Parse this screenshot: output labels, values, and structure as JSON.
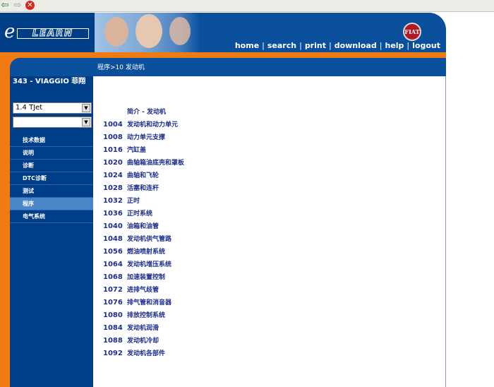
{
  "toolbar": {
    "back_icon": "arrow-left-icon",
    "forward_icon": "arrow-right-icon",
    "stop_icon": "stop-icon",
    "back_glyph": "⇦",
    "forward_glyph": "⇨",
    "stop_glyph": "✕"
  },
  "header": {
    "logo_e": "e",
    "logo_rest": "LEARN",
    "badge": "FIAT",
    "nav": [
      "home",
      "search",
      "print",
      "download",
      "help",
      "logout"
    ],
    "nav_separator": "|"
  },
  "breadcrumb": "程序>10 发动机",
  "sidebar": {
    "model_title": "343 - VIAGGIO 菲翔",
    "select_engine": "1.4 TJet",
    "select_second": "",
    "select_arrow": "▼",
    "menu": [
      {
        "label": "技术数据",
        "active": false
      },
      {
        "label": "说明",
        "active": false
      },
      {
        "label": "诊断",
        "active": false
      },
      {
        "label": "DTC诊断",
        "active": false
      },
      {
        "label": "测试",
        "active": false
      },
      {
        "label": "程序",
        "active": true
      },
      {
        "label": "电气系统",
        "active": false
      }
    ]
  },
  "content": {
    "rows": [
      {
        "code": "",
        "title": "简介 - 发动机"
      },
      {
        "code": "1004",
        "title": "发动机和动力单元"
      },
      {
        "code": "1008",
        "title": "动力单元支撑"
      },
      {
        "code": "1016",
        "title": "汽缸盖"
      },
      {
        "code": "1020",
        "title": "曲轴箱油底壳和罩板"
      },
      {
        "code": "1024",
        "title": "曲轴和飞轮"
      },
      {
        "code": "1028",
        "title": "活塞和连杆"
      },
      {
        "code": "1032",
        "title": "正时"
      },
      {
        "code": "1036",
        "title": "正时系统"
      },
      {
        "code": "1040",
        "title": "油箱和油管"
      },
      {
        "code": "1048",
        "title": "发动机供气管路"
      },
      {
        "code": "1056",
        "title": "燃油喷射系统"
      },
      {
        "code": "1064",
        "title": "发动机增压系统"
      },
      {
        "code": "1068",
        "title": "加速装置控制"
      },
      {
        "code": "1072",
        "title": "进排气歧管"
      },
      {
        "code": "1076",
        "title": "排气管和消音器"
      },
      {
        "code": "1080",
        "title": "排放控制系统"
      },
      {
        "code": "1084",
        "title": "发动机润滑"
      },
      {
        "code": "1088",
        "title": "发动机冷却"
      },
      {
        "code": "1092",
        "title": "发动机各部件"
      }
    ]
  },
  "colors": {
    "brand_blue": "#003f87",
    "header_blue": "#0a4f9c",
    "accent_orange": "#f07a14",
    "active_item": "#4a86c8",
    "link_text": "#1e2f8a"
  }
}
